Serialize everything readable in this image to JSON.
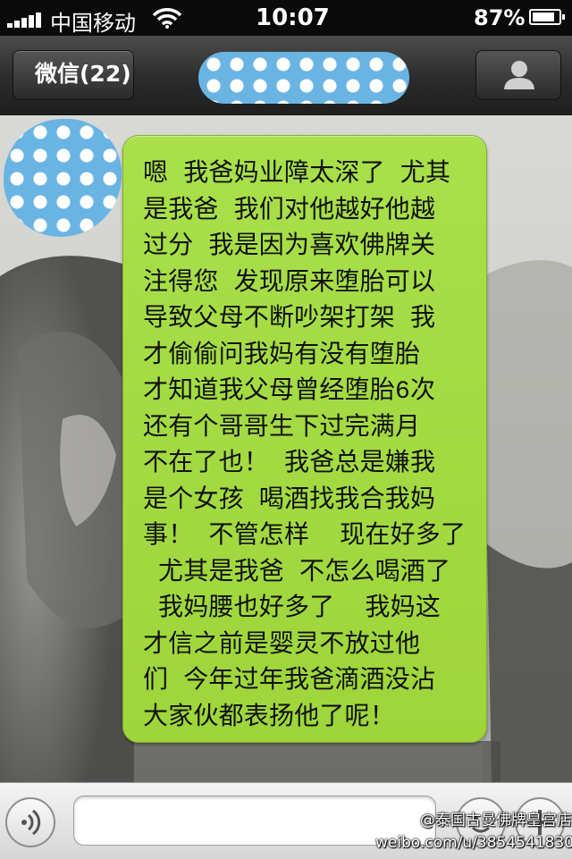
{
  "status_bar": {
    "carrier": "中国移动",
    "time": "10:07",
    "battery_percent": "87%",
    "battery_level": 0.87,
    "signal_bars": 5
  },
  "nav": {
    "back_label": "微信(22)",
    "profile_icon": "person-icon"
  },
  "message": {
    "lines": [
      "嗯 我爸妈业障太深了 尤其",
      "是我爸 我们对他越好他越",
      "过分 我是因为喜欢佛牌关",
      "注得您 发现原来堕胎可以",
      "导致父母不断吵架打架 我",
      "才偷偷问我妈有没有堕胎",
      "才知道我父母曾经堕胎6次",
      "还有个哥哥生下过完满月",
      "不在了也！ 我爸总是嫌我",
      "是个女孩 喝酒找我合我妈",
      "事！ 不管怎样  现在好多了",
      " 尤其是我爸 不怎么喝酒了",
      " 我妈腰也好多了  我妈这",
      "才信之前是婴灵不放过他",
      "们 今年过年我爸滴酒没沾",
      "大家伙都表扬他了呢！"
    ],
    "bubble_color": "#a3da44"
  },
  "input_bar": {
    "voice_icon": "voice-icon",
    "text_value": "",
    "emoji_icon": "emoji-icon",
    "plus_icon": "plus-icon"
  },
  "watermark": {
    "line1": "@泰国古曼佛牌皇宫店",
    "line2": "weibo.com/u/3854541830"
  }
}
